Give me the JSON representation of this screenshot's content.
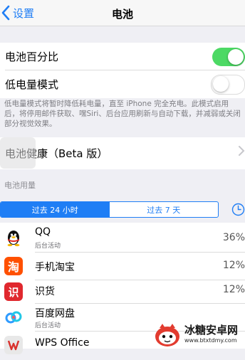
{
  "nav": {
    "back_label": "设置",
    "title": "电池"
  },
  "settings": {
    "battery_percentage_label": "电池百分比",
    "battery_percentage_on": true,
    "low_power_label": "低电量模式",
    "low_power_on": false,
    "low_power_note": "低电量模式将暂时降低耗电量，直至 iPhone 完全充电。此模式启用后，将停用邮件获取、嘿Siri、后台应用刷新与自动下载，并减弱或关闭部分视觉效果。",
    "battery_health_label": "电池健康（Beta 版）"
  },
  "usage": {
    "section_title": "电池用量",
    "tabs": [
      "过去 24 小时",
      "过去 7 天"
    ],
    "active_tab": 0,
    "apps": [
      {
        "name": "QQ",
        "sub": "后台活动",
        "percent": "36%",
        "icon": "qq-penguin-icon"
      },
      {
        "name": "手机淘宝",
        "sub": "",
        "percent": "12%",
        "icon": "taobao-icon",
        "icon_char": "淘"
      },
      {
        "name": "识货",
        "sub": "",
        "percent": "12%",
        "icon": "shihuo-icon",
        "icon_char": "识"
      },
      {
        "name": "百度网盘",
        "sub": "后台活动",
        "percent": "",
        "icon": "baidu-netdisk-icon"
      },
      {
        "name": "WPS Office",
        "sub": "",
        "percent": "",
        "icon": "wps-office-icon"
      }
    ]
  },
  "colors": {
    "accent": "#1f7ef5",
    "toggle_on": "#4cd964",
    "taobao": "#ff5000",
    "shihuo": "#e0282e"
  },
  "watermark": {
    "text": "冰糖安卓网",
    "url": "www.btxtdmy.com"
  }
}
